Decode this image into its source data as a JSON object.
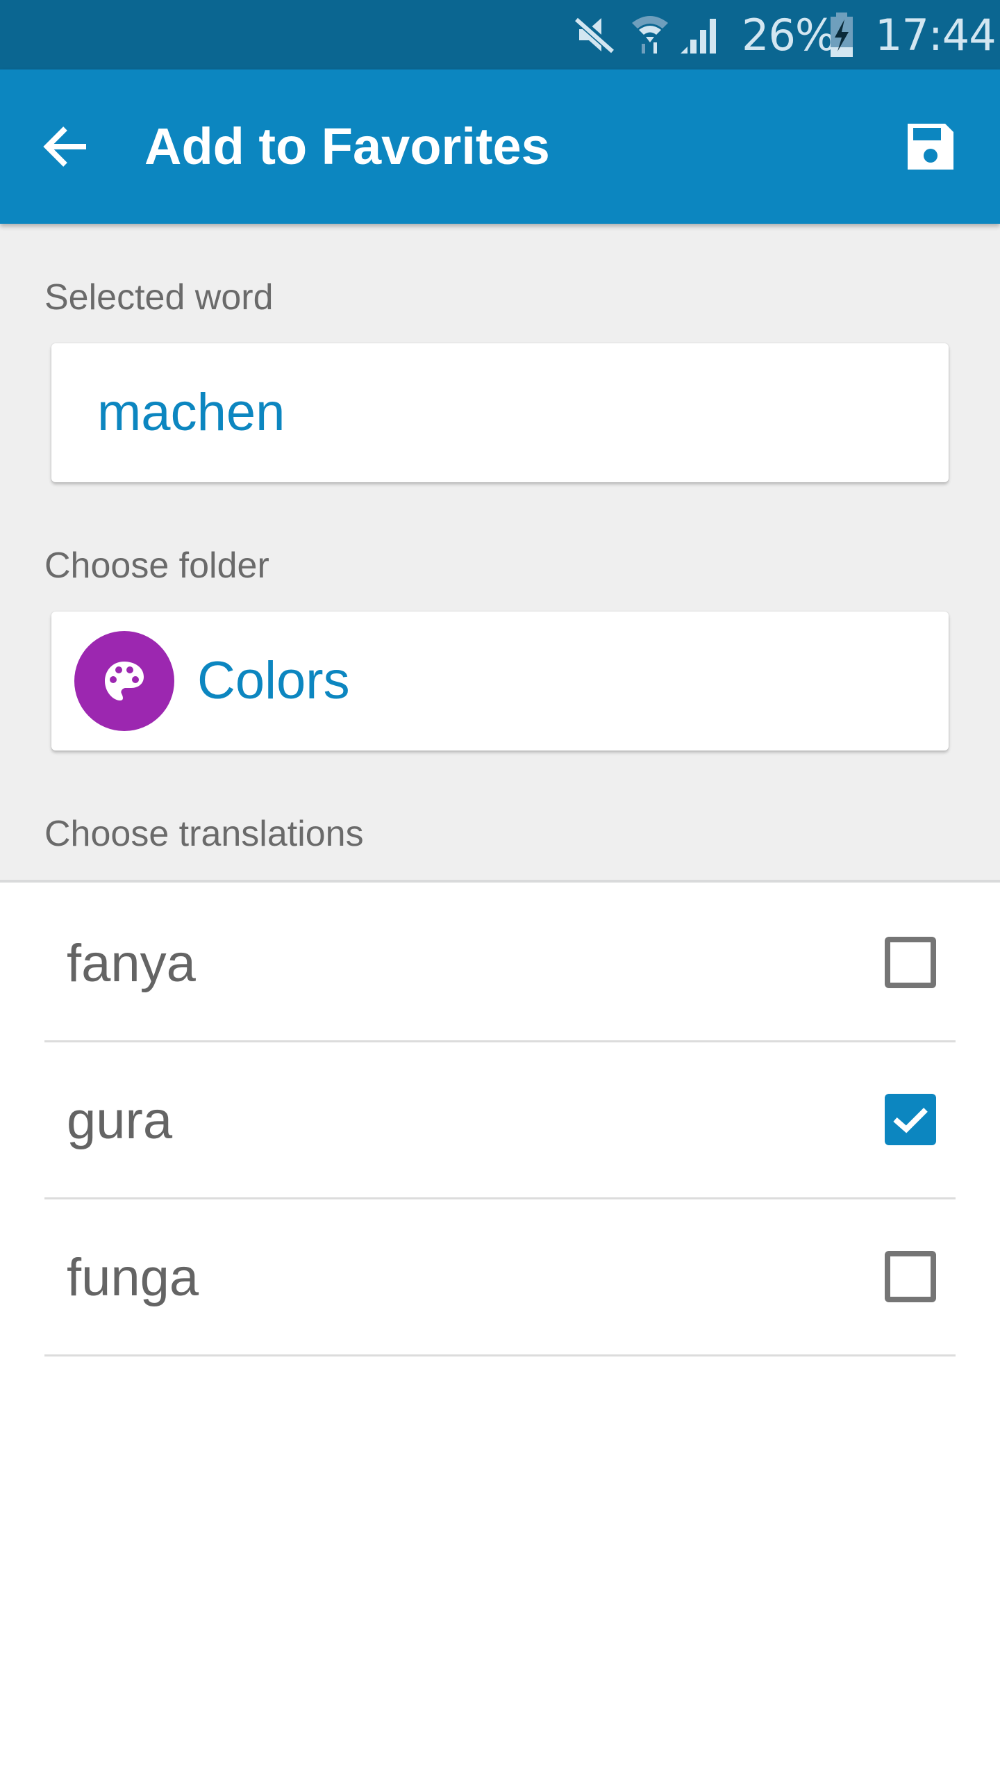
{
  "status_bar": {
    "icons": [
      "mute-icon",
      "wifi-icon",
      "signal-icon",
      "battery-charging-icon"
    ],
    "battery": "26%",
    "time": "17:44"
  },
  "app_bar": {
    "back_icon": "arrow-left-icon",
    "title": "Add to Favorites",
    "save_icon": "floppy-disk-icon"
  },
  "form": {
    "selected_word_label": "Selected word",
    "selected_word_value": "machen",
    "folder_label": "Choose folder",
    "folder": {
      "name": "Colors",
      "icon": "palette-icon",
      "color": "#9c27b0"
    },
    "translations_label": "Choose translations"
  },
  "translations": [
    {
      "label": "fanya",
      "checked": false
    },
    {
      "label": "gura",
      "checked": true
    },
    {
      "label": "funga",
      "checked": false
    }
  ],
  "colors": {
    "primary": "#0c86c0",
    "status_bar": "#0b6691",
    "background": "#efefef",
    "text_secondary": "#6a6a6a"
  }
}
